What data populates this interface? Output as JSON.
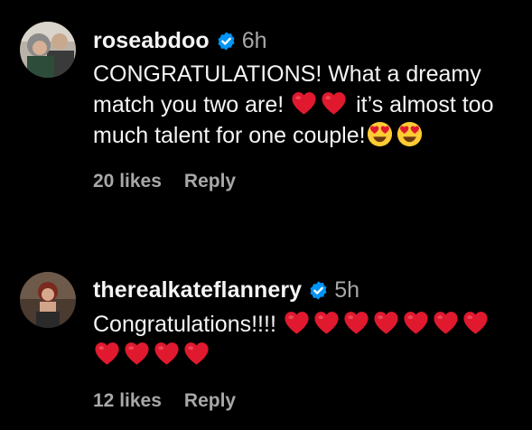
{
  "colors": {
    "background": "#000000",
    "text_primary": "#f5f5f5",
    "text_secondary": "#a8a8a8",
    "verified_badge": "#0095f6",
    "heart": "#e0192f",
    "heart_eyes_face": "#ffcc33"
  },
  "comments": [
    {
      "username": "roseabdoo",
      "verified": true,
      "timestamp": "6h",
      "text_segments": [
        "CONGRATULATIONS! What a dreamy match you two are! ",
        " it’s almost too much talent for one couple!"
      ],
      "emoji_runs": [
        {
          "icon": "red-heart-icon",
          "count": 2
        },
        {
          "icon": "heart-eyes-face-icon",
          "count": 2
        }
      ],
      "likes_label": "20 likes",
      "reply_label": "Reply"
    },
    {
      "username": "therealkateflannery",
      "verified": true,
      "timestamp": "5h",
      "text_segments": [
        "Congratulations!!!! "
      ],
      "emoji_runs": [
        {
          "icon": "red-heart-icon",
          "count": 11
        }
      ],
      "likes_label": "12 likes",
      "reply_label": "Reply"
    }
  ]
}
